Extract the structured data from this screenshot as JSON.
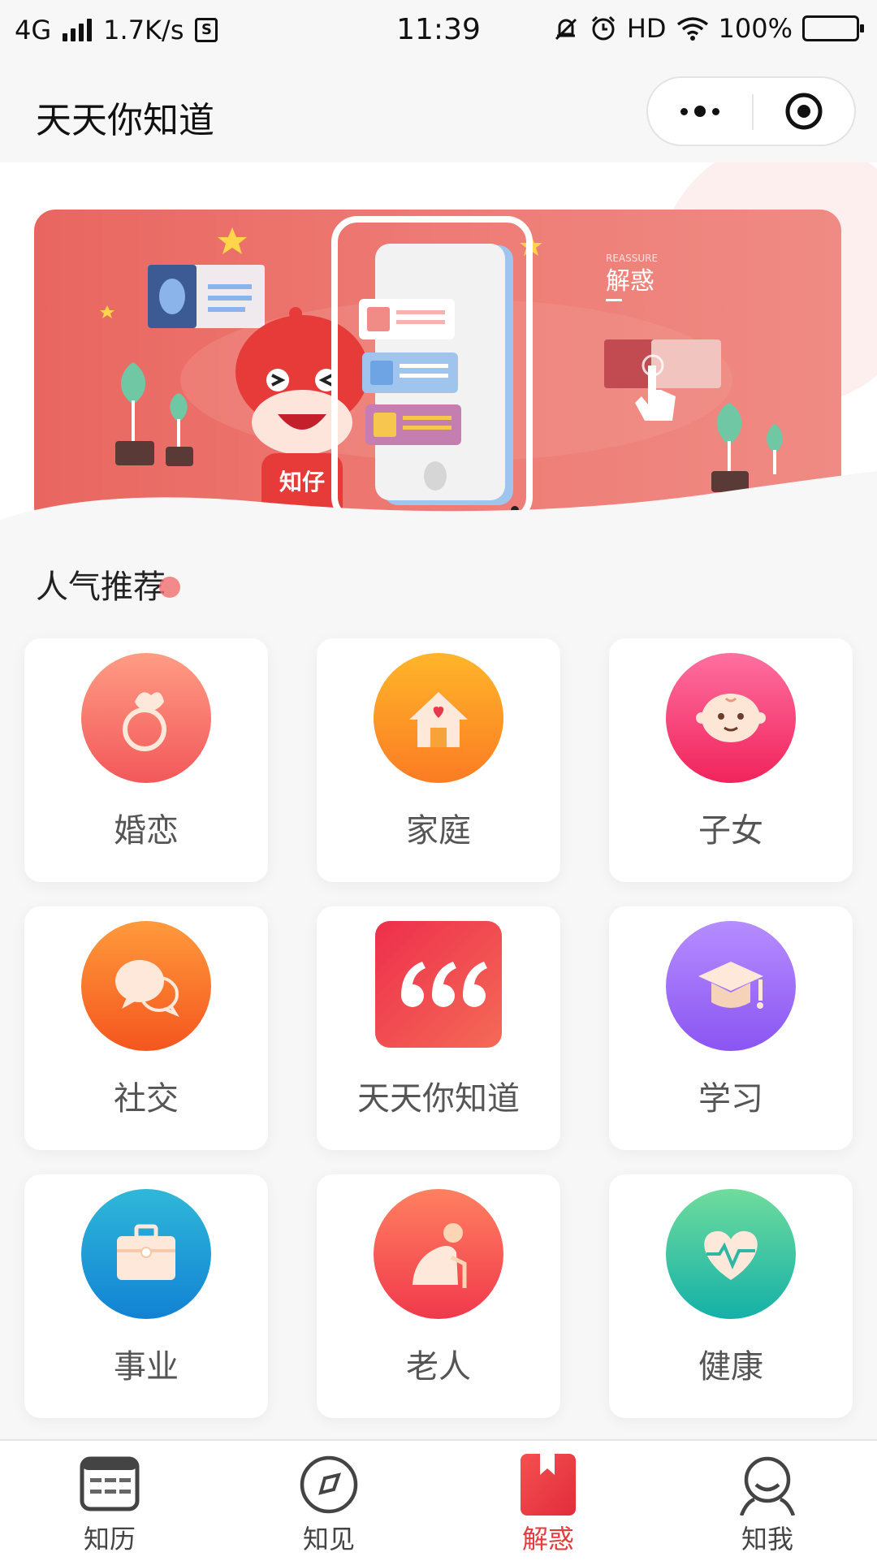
{
  "status_bar": {
    "network": "4G",
    "speed": "1.7K/s",
    "sim": "S",
    "time": "11:39",
    "hd": "HD",
    "battery": "100%",
    "battery_level": 1.0
  },
  "nav": {
    "title": "天天你知道"
  },
  "banner": {
    "tag_en": "REASSURE",
    "tag_cn": "解惑",
    "mascot_label": "知仔"
  },
  "section": {
    "title": "人气推荐"
  },
  "categories": [
    {
      "label": "婚恋",
      "icon": "ring-icon",
      "color_from": "#ff9c84",
      "color_to": "#f2585a"
    },
    {
      "label": "家庭",
      "icon": "house-icon",
      "color_from": "#ffb52a",
      "color_to": "#fb7c24"
    },
    {
      "label": "子女",
      "icon": "baby-face-icon",
      "color_from": "#ff6fa0",
      "color_to": "#f0245c"
    },
    {
      "label": "社交",
      "icon": "chat-bubbles-icon",
      "color_from": "#ff9a3c",
      "color_to": "#f4561e"
    },
    {
      "label": "天天你知道",
      "icon": "quote-icon",
      "color_from": "#f13a4e",
      "color_to": "#f2665a"
    },
    {
      "label": "学习",
      "icon": "graduation-cap-icon",
      "color_from": "#b68dff",
      "color_to": "#8a55f2"
    },
    {
      "label": "事业",
      "icon": "briefcase-icon",
      "color_from": "#2fb8d8",
      "color_to": "#1282d4"
    },
    {
      "label": "老人",
      "icon": "elderly-person-icon",
      "color_from": "#ff8060",
      "color_to": "#f0394c"
    },
    {
      "label": "健康",
      "icon": "heart-pulse-icon",
      "color_from": "#6fdc9c",
      "color_to": "#14b0a8"
    }
  ],
  "tabs": [
    {
      "label": "知历",
      "icon": "calendar-icon",
      "active": false
    },
    {
      "label": "知见",
      "icon": "compass-icon",
      "active": false
    },
    {
      "label": "解惑",
      "icon": "book-icon",
      "active": true
    },
    {
      "label": "知我",
      "icon": "user-icon",
      "active": false
    }
  ],
  "colors": {
    "accent": "#e43c3f",
    "banner": "#ec726b"
  }
}
